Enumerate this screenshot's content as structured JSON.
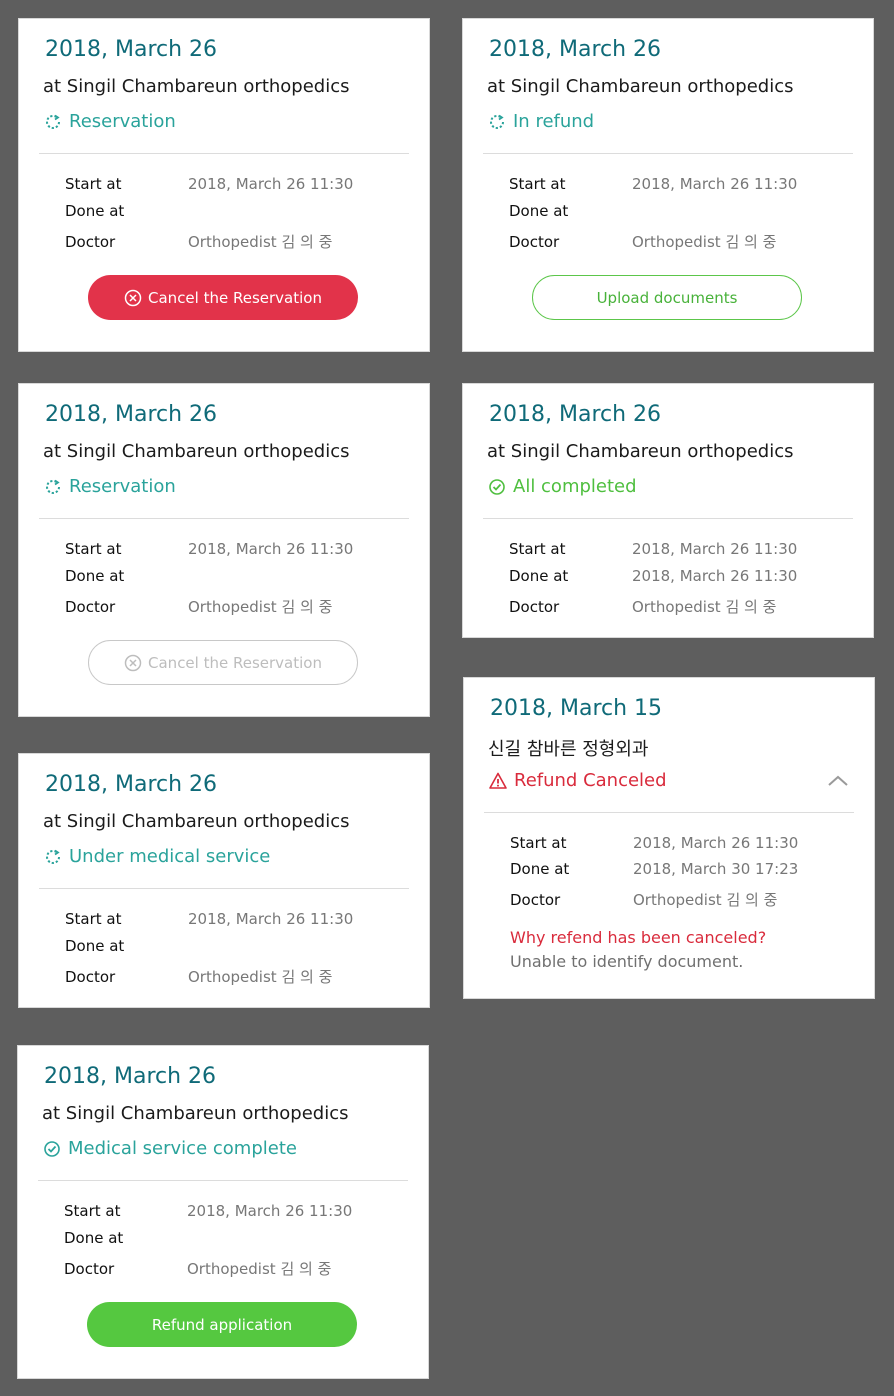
{
  "colors": {
    "background": "#5e5e5e",
    "date": "#0f6a78",
    "status_teal": "#2aa39b",
    "status_green": "#4fbf3f",
    "status_red": "#d92b3c",
    "button_red": "#e2334a",
    "button_green": "#55c840"
  },
  "labels": {
    "start": "Start at",
    "done": "Done at",
    "doctor": "Doctor"
  },
  "cards": [
    {
      "date": "2018, March 26",
      "place": "at Singil Chambareun orthopedics",
      "status": "Reservation",
      "status_icon": "refresh-icon",
      "start": "2018, March 26 11:30",
      "done": "",
      "doctor": "Orthopedist 김 의 중",
      "button": "Cancel the Reservation"
    },
    {
      "date": "2018, March 26",
      "place": "at Singil Chambareun orthopedics",
      "status": "In refund",
      "status_icon": "refresh-icon",
      "start": "2018, March 26 11:30",
      "done": "",
      "doctor": "Orthopedist 김 의 중",
      "button": "Upload documents"
    },
    {
      "date": "2018, March 26",
      "place": "at Singil Chambareun orthopedics",
      "status": "Reservation",
      "status_icon": "refresh-icon",
      "start": "2018, March 26 11:30",
      "done": "",
      "doctor": "Orthopedist 김 의 중",
      "button": "Cancel the Reservation"
    },
    {
      "date": "2018, March 26",
      "place": "at Singil Chambareun orthopedics",
      "status": "All completed",
      "status_icon": "check-circle-icon",
      "start": "2018, March 26 11:30",
      "done": "2018, March 26 11:30",
      "doctor": "Orthopedist 김 의 중"
    },
    {
      "date": "2018, March 15",
      "place": "신길 참바른 정형외과",
      "status": "Refund Canceled",
      "status_icon": "warning-icon",
      "start": "2018, March 26 11:30",
      "done": "2018, March 30 17:23",
      "doctor": "Orthopedist 김 의 중",
      "reason_title": "Why refend has been canceled?",
      "reason_text": "Unable to identify document."
    },
    {
      "date": "2018, March 26",
      "place": "at Singil Chambareun orthopedics",
      "status": "Under medical service",
      "status_icon": "refresh-icon",
      "start": "2018, March 26 11:30",
      "done": "",
      "doctor": "Orthopedist 김 의 중"
    },
    {
      "date": "2018, March 26",
      "place": "at Singil Chambareun orthopedics",
      "status": "Medical service complete",
      "status_icon": "check-circle-icon",
      "start": "2018, March 26 11:30",
      "done": "",
      "doctor": "Orthopedist 김 의 중",
      "button": "Refund application"
    }
  ]
}
